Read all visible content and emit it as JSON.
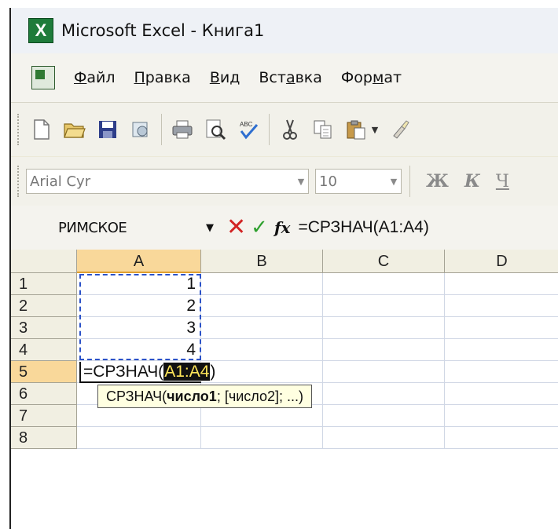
{
  "window": {
    "title": "Microsoft Excel - Книга1",
    "app_icon": "excel-logo-icon"
  },
  "menu": {
    "items": [
      {
        "pre": "",
        "key": "Ф",
        "post": "айл"
      },
      {
        "pre": "",
        "key": "П",
        "post": "равка"
      },
      {
        "pre": "",
        "key": "В",
        "post": "ид"
      },
      {
        "pre": "Вст",
        "key": "а",
        "post": "вка"
      },
      {
        "pre": "Фор",
        "key": "м",
        "post": "ат"
      }
    ]
  },
  "toolbar": {
    "icons": [
      "new-document-icon",
      "open-folder-icon",
      "save-icon",
      "permission-icon",
      "print-icon",
      "print-preview-icon",
      "spelling-icon",
      "cut-icon",
      "copy-icon",
      "paste-icon",
      "format-painter-icon"
    ]
  },
  "format": {
    "font_name": "Arial Cyr",
    "font_size": "10",
    "bold_label": "Ж",
    "italic_label": "К",
    "underline_label": "Ч"
  },
  "formula_bar": {
    "name_box": "РИМСКОЕ",
    "formula": "=СРЗНАЧ(A1:A4)"
  },
  "grid": {
    "columns": [
      "A",
      "B",
      "C",
      "D"
    ],
    "rows": [
      "1",
      "2",
      "3",
      "4",
      "5",
      "6",
      "7",
      "8"
    ],
    "cells": {
      "A1": "1",
      "A2": "2",
      "A3": "3",
      "A4": "4"
    },
    "active_cell": "A5",
    "edit_prefix": "=СРЗНАЧ(",
    "edit_ref": "A1:A4",
    "edit_suffix": ")"
  },
  "tooltip": {
    "func": "СРЗНАЧ(",
    "arg1": "число1",
    "rest": "; [число2]; ...)"
  },
  "colors": {
    "title_bg": "#eef1f6",
    "marquee": "#2b52c8",
    "tooltip_bg": "#ffffe1",
    "active_header": "#f9d89a"
  }
}
